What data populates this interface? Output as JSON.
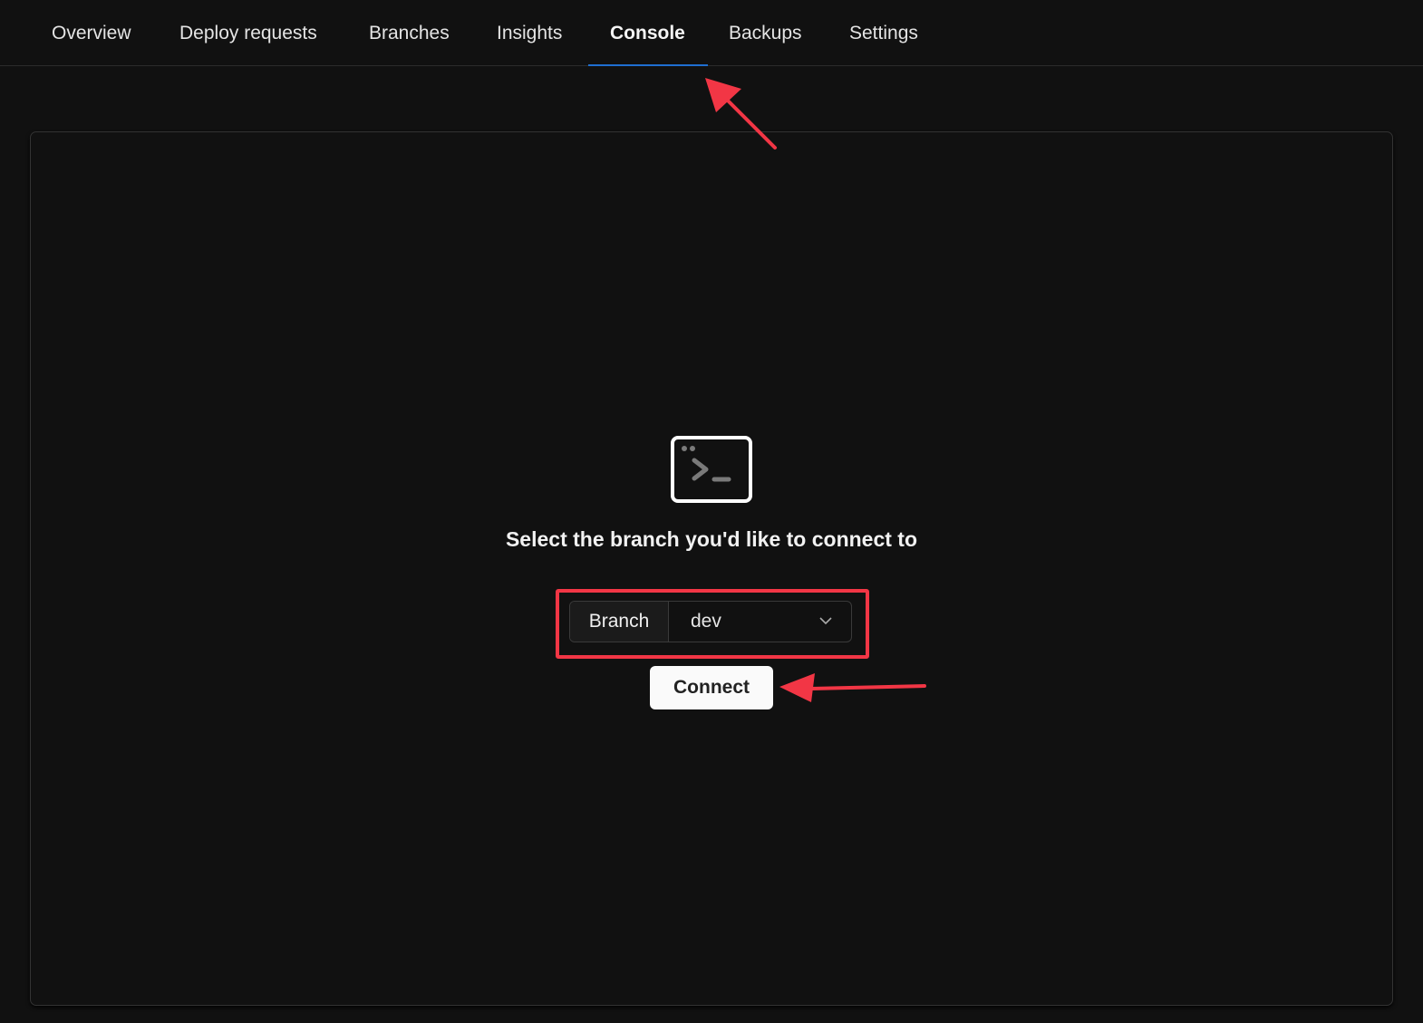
{
  "tabs": [
    {
      "label": "Overview",
      "active": false
    },
    {
      "label": "Deploy requests",
      "active": false
    },
    {
      "label": "Branches",
      "active": false
    },
    {
      "label": "Insights",
      "active": false
    },
    {
      "label": "Console",
      "active": true
    },
    {
      "label": "Backups",
      "active": false
    },
    {
      "label": "Settings",
      "active": false
    }
  ],
  "console": {
    "icon": "terminal-icon",
    "prompt": "Select the branch you'd like to connect to",
    "branch_select": {
      "label": "Branch",
      "value": "dev"
    },
    "connect_label": "Connect"
  },
  "colors": {
    "accent": "#1f6fd1",
    "annotation": "#f23645",
    "background": "#111111"
  }
}
